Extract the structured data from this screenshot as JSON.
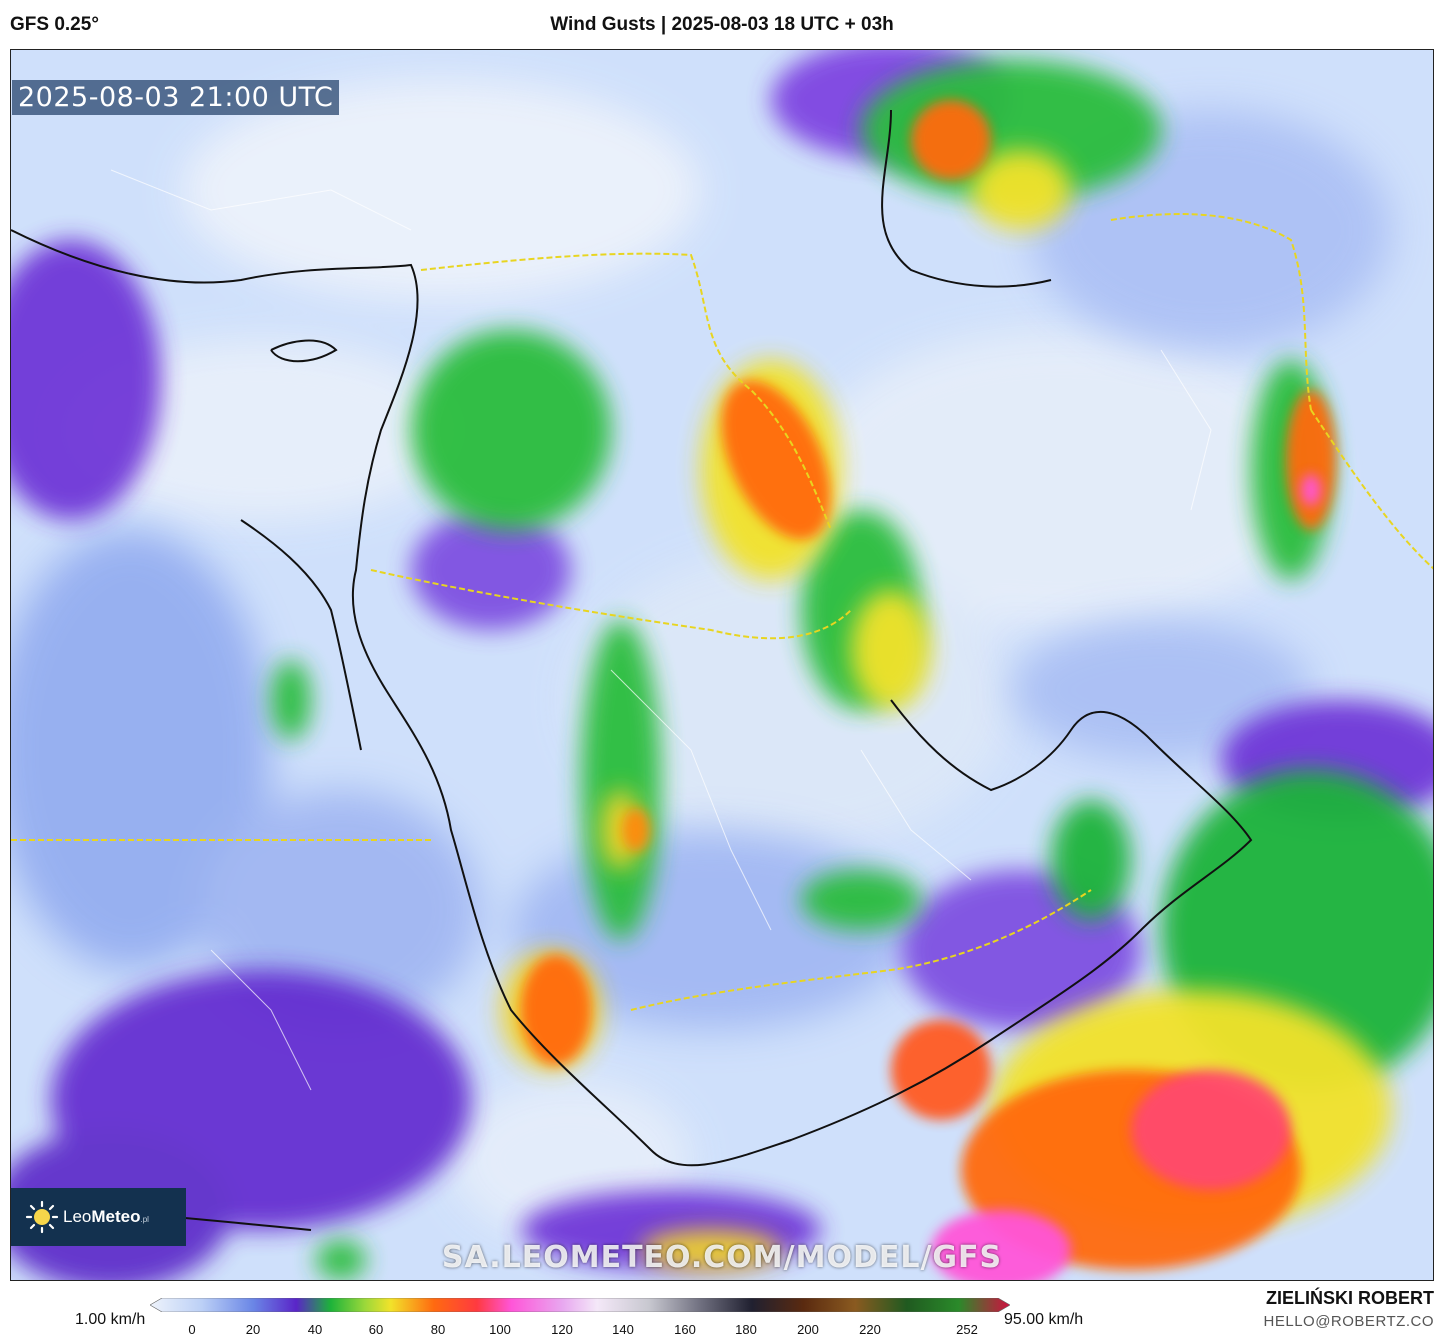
{
  "header": {
    "model": "GFS 0.25°",
    "title": "Wind Gusts | 2025-08-03 18 UTC + 03h"
  },
  "map": {
    "valid_time": "2025-08-03 21:00 UTC",
    "watermark": "SA.LEOMETEO.COM/MODEL/GFS",
    "logo": {
      "name": "LeoMeteo",
      "name_light": "Leo",
      "name_bold": "Meteo",
      "suffix": ".pl"
    },
    "colors": {
      "background_low": "#cfe0fb",
      "purple": "#6b2fd6",
      "green": "#1db33a",
      "yellow": "#f2e22a",
      "orange": "#ff6a10",
      "magenta": "#ff55d8"
    }
  },
  "colorbar": {
    "min_label": "1.00 km/h",
    "max_label": "95.00 km/h",
    "ticks": [
      "0",
      "20",
      "40",
      "60",
      "80",
      "100",
      "120",
      "140",
      "160",
      "180",
      "200",
      "220",
      "252"
    ]
  },
  "footer": {
    "author": "ZIELIŃSKI ROBERT",
    "email": "HELLO@ROBERTZ.CO"
  }
}
